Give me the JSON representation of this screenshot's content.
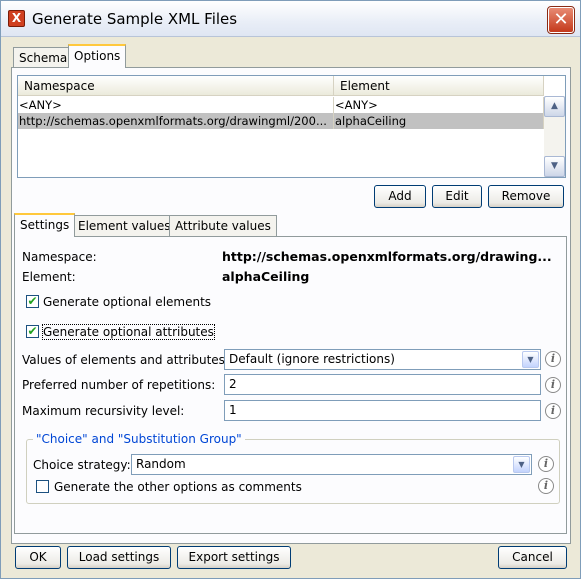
{
  "window": {
    "title": "Generate Sample XML Files",
    "app_icon_glyph": "X",
    "close_glyph": "✕"
  },
  "top_tabs": [
    "Schema",
    "Options"
  ],
  "grid": {
    "columns": [
      "Namespace",
      "Element"
    ],
    "rows": [
      {
        "namespace": "<ANY>",
        "element": "<ANY>",
        "selected": false
      },
      {
        "namespace": "http://schemas.openxmlformats.org/drawingml/200...",
        "element": "alphaCeiling",
        "selected": true
      }
    ]
  },
  "grid_buttons": {
    "add": "Add",
    "edit": "Edit",
    "remove": "Remove"
  },
  "inner_tabs": [
    "Settings",
    "Element values",
    "Attribute values"
  ],
  "settings": {
    "namespace_label": "Namespace:",
    "namespace_value": "http://schemas.openxmlformats.org/drawing...",
    "element_label": "Element:",
    "element_value": "alphaCeiling",
    "gen_optional_elements": {
      "label": "Generate optional elements",
      "checked": true
    },
    "gen_optional_attributes": {
      "label": "Generate optional attributes",
      "checked": true
    },
    "values_label": "Values of elements and attributes:",
    "values_selected": "Default (ignore restrictions)",
    "repetitions_label": "Preferred number of repetitions:",
    "repetitions_value": "2",
    "recursivity_label": "Maximum recursivity level:",
    "recursivity_value": "1",
    "group_title": "\"Choice\" and \"Substitution Group\"",
    "choice_label": "Choice strategy:",
    "choice_selected": "Random",
    "gen_other_options": {
      "label": "Generate the other options as comments",
      "checked": false
    }
  },
  "footer": {
    "ok": "OK",
    "load": "Load settings",
    "export": "Export settings",
    "cancel": "Cancel"
  },
  "colors": {
    "tab_highlight": "#ffc83c",
    "group_title": "#0046d5",
    "check": "#21a121"
  }
}
